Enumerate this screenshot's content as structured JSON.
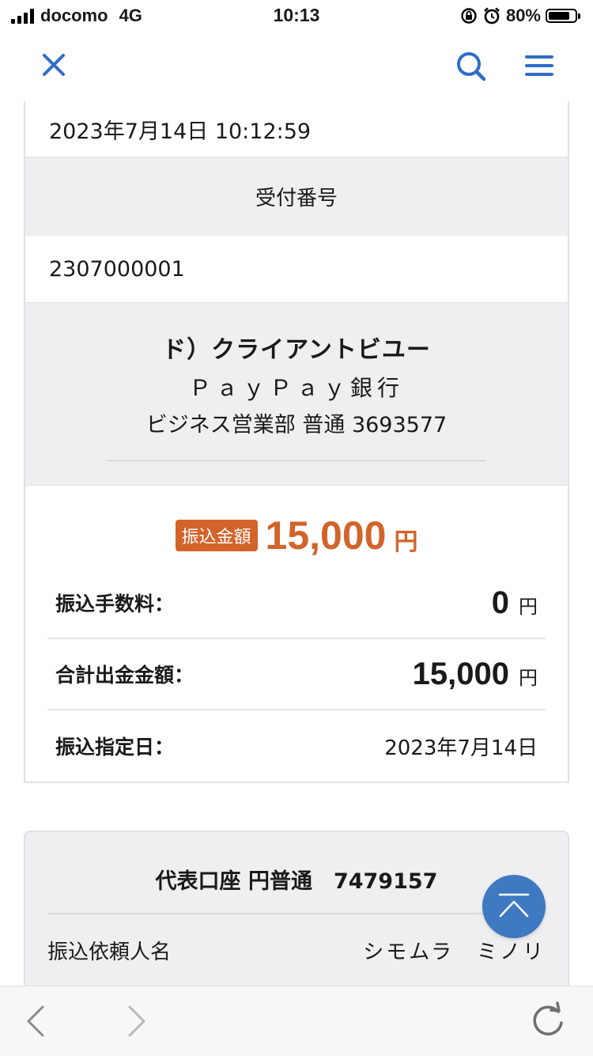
{
  "status_bar": {
    "carrier": "docomo",
    "network": "4G",
    "time": "10:13",
    "battery_text": "80%",
    "battery_level": 0.8
  },
  "nav": {
    "close_icon": "close-icon",
    "search_icon": "search-icon",
    "menu_icon": "menu-icon",
    "accent_color": "#2f6cc6"
  },
  "transaction": {
    "datetime": "2023年7月14日 10:12:59",
    "receipt_label": "受付番号",
    "receipt_number": "2307000001"
  },
  "payee": {
    "name": "ド）クライアントビユー",
    "bank": "ＰａｙＰａｙ銀行",
    "branch_account": "ビジネス営業部 普通 3693577"
  },
  "amount": {
    "badge": "振込金額",
    "value": "15,000",
    "unit": "円",
    "color": "#d2642a"
  },
  "details": {
    "fee_label": "振込手数料：",
    "fee_value": "0",
    "fee_unit": "円",
    "total_label": "合計出金金額：",
    "total_value": "15,000",
    "total_unit": "円",
    "date_label": "振込指定日：",
    "date_value": "2023年7月14日"
  },
  "source_account": {
    "title": "代表口座 円普通　7479157",
    "requester_label": "振込依頼人名",
    "requester_value": "シモムラ　ミノリ"
  },
  "fab": {
    "icon": "scroll-to-top-icon"
  },
  "toolbar": {
    "back_icon": "back-chevron-icon",
    "forward_icon": "forward-chevron-icon",
    "reload_icon": "reload-icon"
  }
}
